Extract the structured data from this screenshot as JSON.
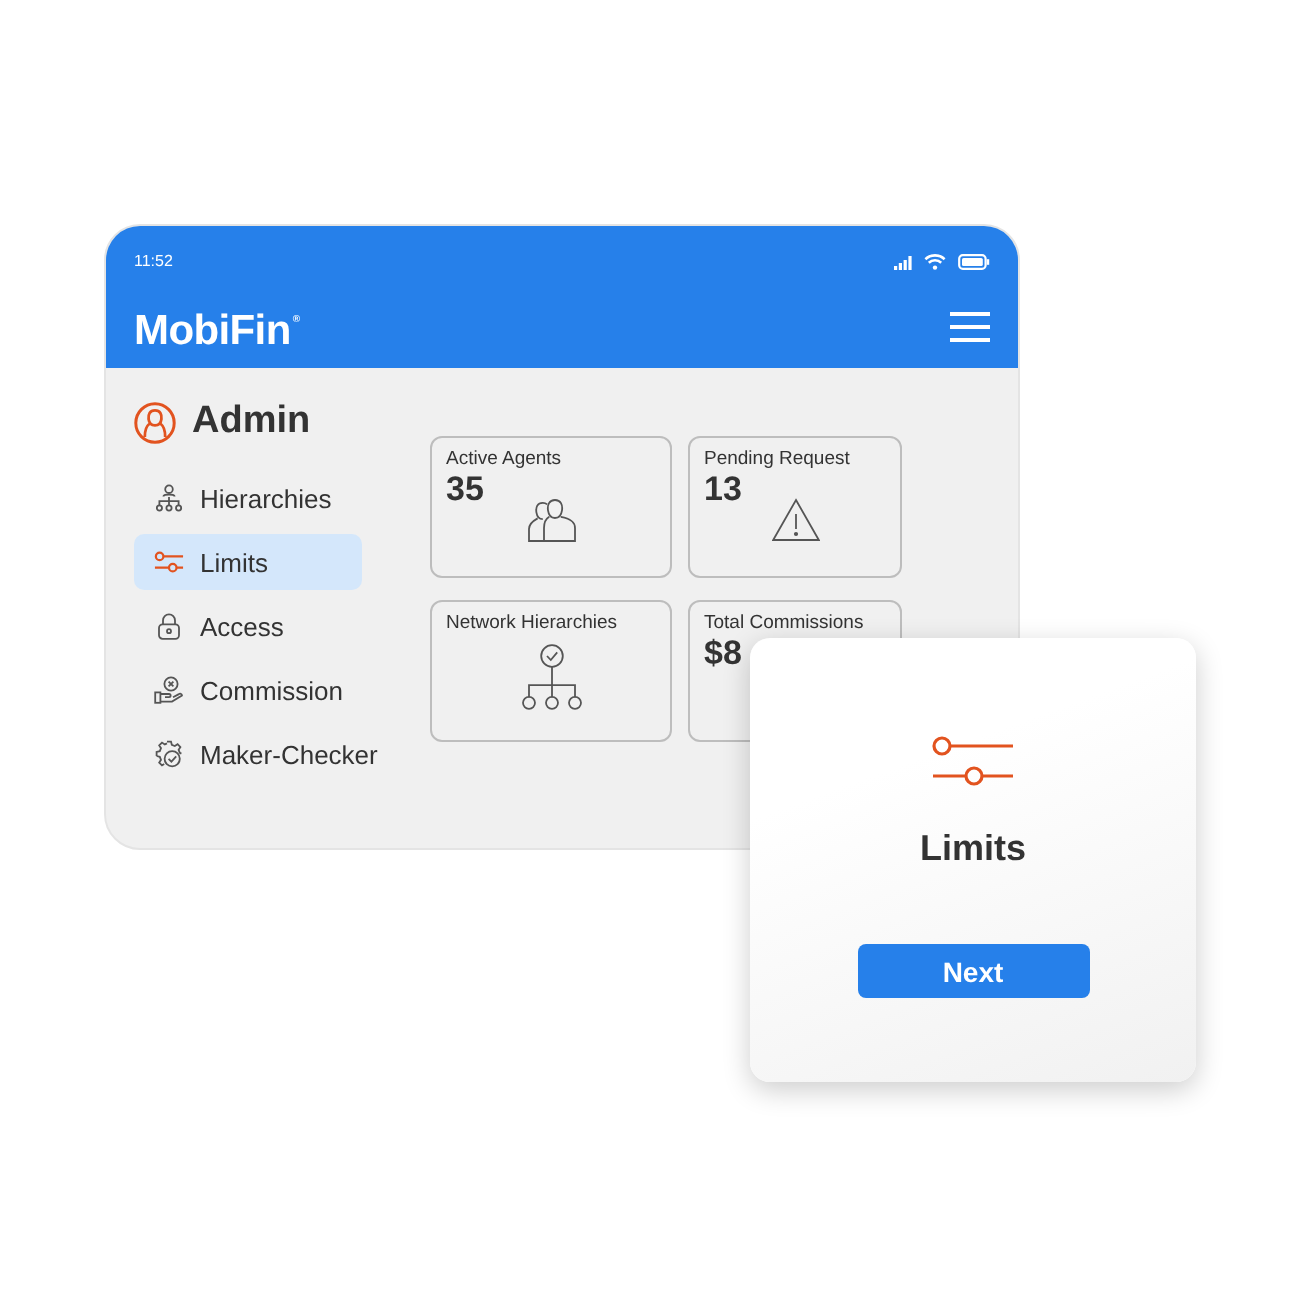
{
  "status_bar": {
    "time": "11:52"
  },
  "header": {
    "logo": "MobiFin$^{®}$"
  },
  "sidebar": {
    "title": "Admin",
    "items": [
      {
        "label": "Hierarchies",
        "selected": false
      },
      {
        "label": "Limits",
        "selected": true
      },
      {
        "label": "Access",
        "selected": false
      },
      {
        "label": "Commission",
        "selected": false
      },
      {
        "label": "Maker-Checker",
        "selected": false
      }
    ]
  },
  "cards": [
    {
      "title": "Active Agents",
      "value": "35"
    },
    {
      "title": "Pending Request",
      "value": "13"
    },
    {
      "title": "Network Hierarchies"
    },
    {
      "title": "Total Commissions",
      "value": "$8"
    }
  ],
  "popup": {
    "title": "Limits",
    "button": "Next"
  }
}
